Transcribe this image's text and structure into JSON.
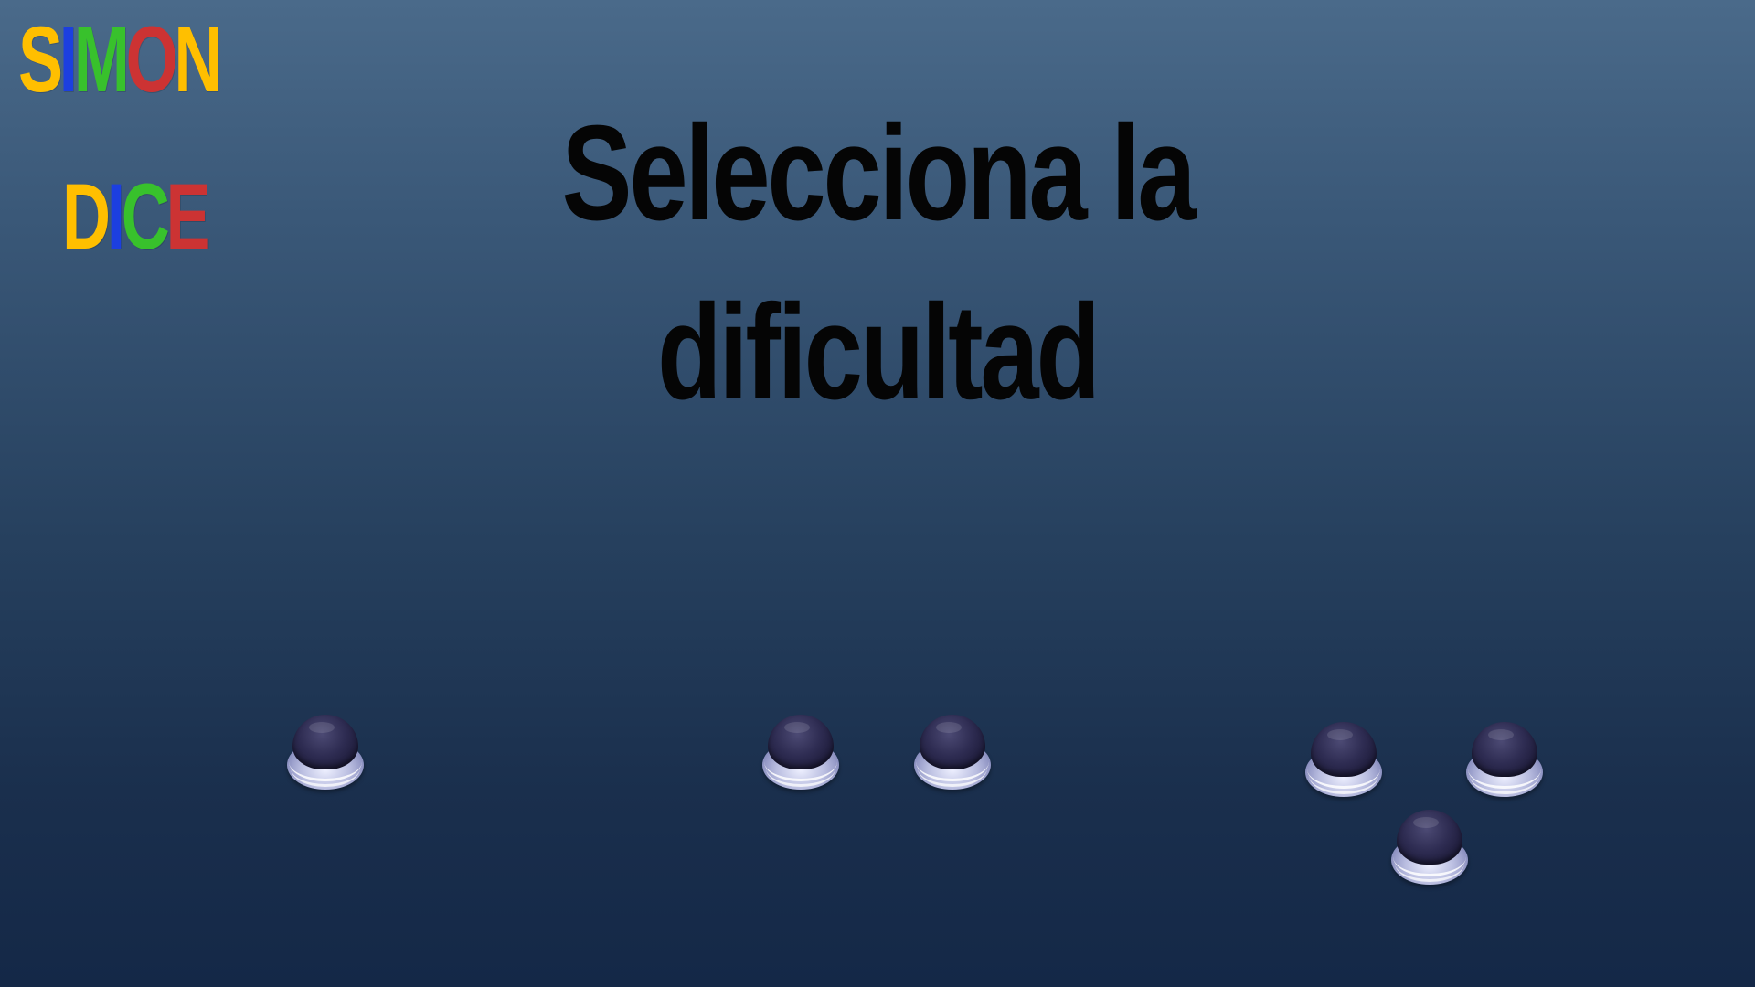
{
  "logo": {
    "line1": [
      {
        "letter": "S",
        "color": "#ffbf00"
      },
      {
        "letter": "I",
        "color": "#1c3fe0"
      },
      {
        "letter": "M",
        "color": "#38c12c"
      },
      {
        "letter": "O",
        "color": "#cc3333"
      },
      {
        "letter": "N",
        "color": "#ffbf00"
      }
    ],
    "line2": [
      {
        "letter": "D",
        "color": "#ffbf00"
      },
      {
        "letter": "I",
        "color": "#1c3fe0"
      },
      {
        "letter": "C",
        "color": "#38c12c"
      },
      {
        "letter": "E",
        "color": "#cc3333"
      }
    ]
  },
  "title": {
    "line1": "Selecciona la",
    "line2": "dificultad"
  },
  "difficulty_options": [
    {
      "name": "one-button",
      "buttons": 1
    },
    {
      "name": "two-buttons",
      "buttons": 2
    },
    {
      "name": "three-buttons",
      "buttons": 3
    }
  ],
  "colors": {
    "background_top": "#4a6a8a",
    "background_bottom": "#142847",
    "title": "#050505",
    "button_cap": "#2e2c52",
    "button_base": "#b9bde0"
  }
}
